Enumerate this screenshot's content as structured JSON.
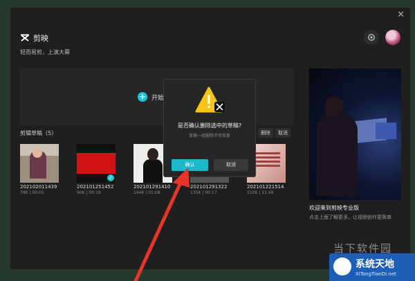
{
  "app": {
    "name": "剪映",
    "slogan": "轻而易剪，上演大幕",
    "close_symbol": "✕"
  },
  "create": {
    "label": "开始创作"
  },
  "drafts": {
    "title": "剪辑草稿（5）",
    "actions": [
      "删除",
      "取消"
    ],
    "items": [
      {
        "name": "202102011439",
        "meta": "78K | 00:05",
        "selected": false
      },
      {
        "name": "202101251452",
        "meta": "90K | 00:19",
        "selected": true
      },
      {
        "name": "202101291410",
        "meta": "144K | 01:08",
        "selected": false
      },
      {
        "name": "202101291322",
        "meta": "135K | 00:17",
        "selected": false
      },
      {
        "name": "202101221514",
        "meta": "310K | 11:49",
        "selected": false
      }
    ]
  },
  "side": {
    "title": "欢迎来到剪映专业版",
    "desc": "点击上面了解更多，让视频创作更简单"
  },
  "dialog": {
    "title": "是否确认删除选中的草稿?",
    "subtitle": "草稿一经删除不可恢复",
    "confirm": "确认",
    "cancel": "取消"
  },
  "watermark": {
    "text": "当下软件园",
    "badge_title": "系统天地",
    "badge_url": "XiTongTianDi.net"
  },
  "colors": {
    "accent": "#1ab8c8",
    "warning": "#f5c518",
    "arrow": "#e8352a"
  }
}
